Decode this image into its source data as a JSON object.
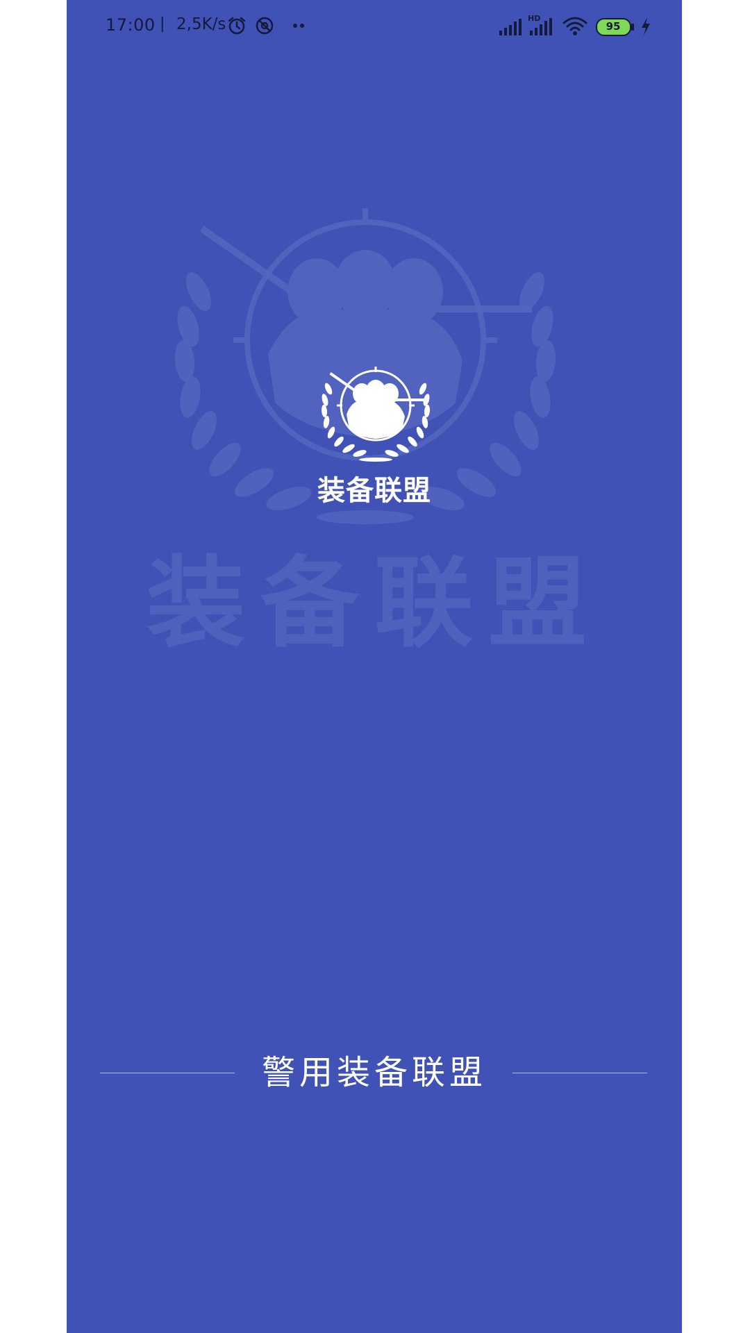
{
  "status_bar": {
    "time": "17:00",
    "separator": "|",
    "network_speed": "2,5K/s",
    "battery_level": "95",
    "signal_hd_label": "HD",
    "colors": {
      "battery_fill": "#7ed957",
      "icons": "#15193a"
    }
  },
  "splash": {
    "background_color": "#4152b7",
    "logo_title": "装备联盟",
    "watermark_text": "装备联盟",
    "footer_title": "警用装备联盟"
  },
  "icons": {
    "alarm": "alarm-clock-icon",
    "dnd": "do-not-disturb-icon",
    "more": "more-dots-icon",
    "signal": "cellular-signal-icon",
    "wifi": "wifi-icon",
    "battery": "battery-icon",
    "charging": "charging-bolt-icon",
    "emblem": "police-emblem-icon"
  }
}
